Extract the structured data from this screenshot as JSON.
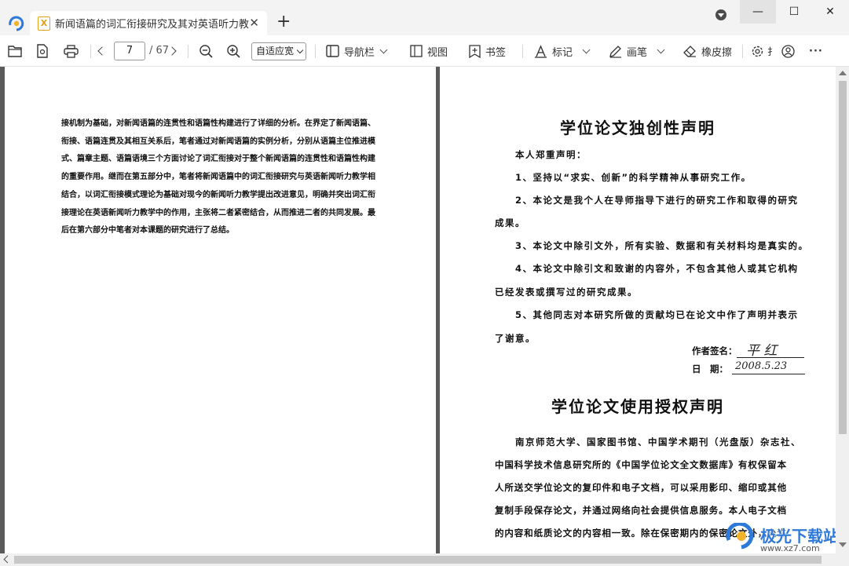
{
  "tab": {
    "title": "新闻语篇的词汇衔接研究及其对英语听力教...",
    "file_badge": "X"
  },
  "window": {
    "minimize": "—",
    "maximize": "☐",
    "close": "✕"
  },
  "toolbar": {
    "page_current": "7",
    "page_total": "/ 67",
    "zoom_mode": "自适应宽",
    "nav_label": "导航栏",
    "view_label": "视图",
    "bookmark_label": "书签",
    "mark_label": "标记",
    "pen_label": "画笔",
    "eraser_label": "橡皮擦",
    "settings_label": "扌",
    "more_label": "···"
  },
  "left_page": {
    "lines": [
      "接机制为基础，对新闻语篇的连贯性和语篇性构建进行了详细的分析。在界定了新闻语篇、",
      "衔接、语篇连贯及其相互关系后，笔者通过对新闻语篇的实例分析，分别从语篇主位推进模",
      "式、篇章主题、语篇语境三个方面讨论了词汇衔接对于整个新闻语篇的连贯性和语篇性构建",
      "的重要作用。继而在第五部分中，笔者将新闻语篇中的词汇衔接研究与英语新闻听力教学相",
      "结合，以词汇衔接模式理论为基础对现今的新闻听力教学提出改进意见，明确并突出词汇衔",
      "接理论在英语新闻听力教学中的作用，主张将二者紧密结合，从而推进二者的共同发展。最",
      "后在第六部分中笔者对本课题的研究进行了总结。"
    ]
  },
  "right_page": {
    "title1": "学位论文独创性声明",
    "statement_lines": [
      "本人郑重声明：",
      "1、坚持以“求实、创新”的科学精神从事研究工作。",
      "2、本论文是我个人在导师指导下进行的研究工作和取得的研究",
      "成果。",
      "3、本论文中除引文外，所有实验、数据和有关材料均是真实的。",
      "4、本论文中除引文和致谢的内容外，不包含其他人或其它机构",
      "已经发表或撰写过的研究成果。",
      "5、其他同志对本研究所做的贡献均已在论文中作了声明并表示",
      "了谢意。"
    ],
    "author_sign_label": "作者签名：",
    "author_signature": "平 红",
    "date_label": "日　期：",
    "date_signature": "2008.5.23",
    "title2": "学位论文使用授权声明",
    "auth_lines": [
      "南京师范大学、国家图书馆、中国学术期刊（光盘版）杂志社、",
      "中国科学技术信息研究所的《中国学位论文全文数据库》有权保留本",
      "人所送交学位论文的复印件和电子文档，可以采用影印、缩印或其他",
      "复制手段保存论文，并通过网络向社会提供信息服务。本人电子文档",
      "的内容和纸质论文的内容相一致。除在保密期内的保密论文外，允许"
    ]
  },
  "watermark": {
    "text": "极光下载站",
    "url": "www.xz7.com"
  },
  "colors": {
    "accent": "#2f7ad8",
    "tab_icon": "#e0a21b",
    "doc_background": "#5a5a5a"
  }
}
